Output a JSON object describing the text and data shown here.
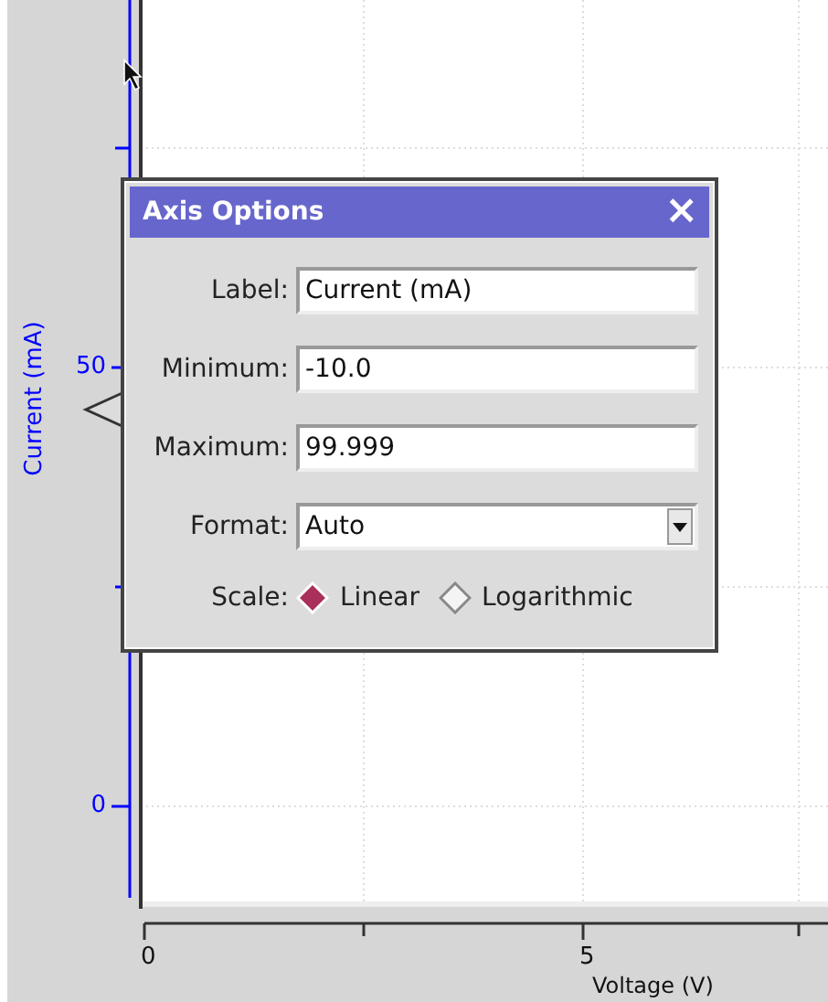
{
  "y_axis": {
    "label": "Current (mA)",
    "ticks": [
      {
        "kind": "minor"
      },
      {
        "kind": "major",
        "label": "50"
      },
      {
        "kind": "minor"
      },
      {
        "kind": "major",
        "label": "0"
      }
    ]
  },
  "x_axis": {
    "label": "Voltage (V)",
    "ticks": [
      {
        "kind": "major",
        "label": "0"
      },
      {
        "kind": "minor"
      },
      {
        "kind": "major",
        "label": "5"
      },
      {
        "kind": "minor"
      }
    ]
  },
  "dialog": {
    "title": "Axis Options",
    "close": "×",
    "fields": [
      {
        "kind": "text",
        "label": "Label:",
        "value": "Current (mA)"
      },
      {
        "kind": "text",
        "label": "Minimum:",
        "value": "-10.0"
      },
      {
        "kind": "text",
        "label": "Maximum:",
        "value": "99.999"
      },
      {
        "kind": "select",
        "label": "Format:",
        "value": "Auto"
      }
    ],
    "scale": {
      "label": "Scale:",
      "options": [
        {
          "label": "Linear",
          "selected": true
        },
        {
          "label": "Logarithmic",
          "selected": false
        }
      ]
    }
  }
}
